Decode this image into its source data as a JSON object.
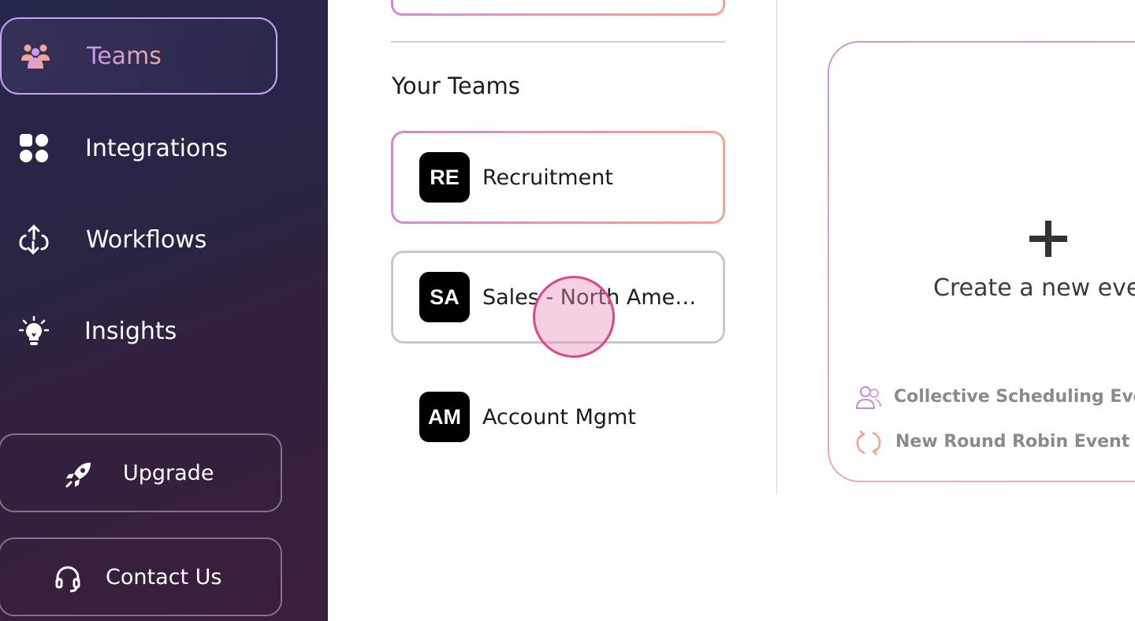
{
  "sidebar": {
    "items": [
      {
        "label": "Teams",
        "icon": "users-icon",
        "active": true
      },
      {
        "label": "Integrations",
        "icon": "grid-icon",
        "active": false
      },
      {
        "label": "Workflows",
        "icon": "workflow-icon",
        "active": false
      },
      {
        "label": "Insights",
        "icon": "lightbulb-icon",
        "active": false
      }
    ],
    "upgrade_label": "Upgrade",
    "contact_label": "Contact Us"
  },
  "teams": {
    "section_title": "Your Teams",
    "items": [
      {
        "initials": "RE",
        "name": "Recruitment",
        "selected": true
      },
      {
        "initials": "SA",
        "name": "Sales - North America",
        "selected": false
      },
      {
        "initials": "AM",
        "name": "Account Mgmt",
        "selected": false
      }
    ]
  },
  "create_card": {
    "title": "Create a new event",
    "options": [
      {
        "label": "Collective Scheduling Event",
        "icon": "people-icon"
      },
      {
        "label": "New Round Robin Event",
        "icon": "round-robin-icon"
      }
    ]
  },
  "colors": {
    "accent_purple": "#c39af0",
    "accent_peach": "#f2a6a0",
    "sidebar_bg": "#2a2445",
    "click_marker": "#d9478c"
  }
}
